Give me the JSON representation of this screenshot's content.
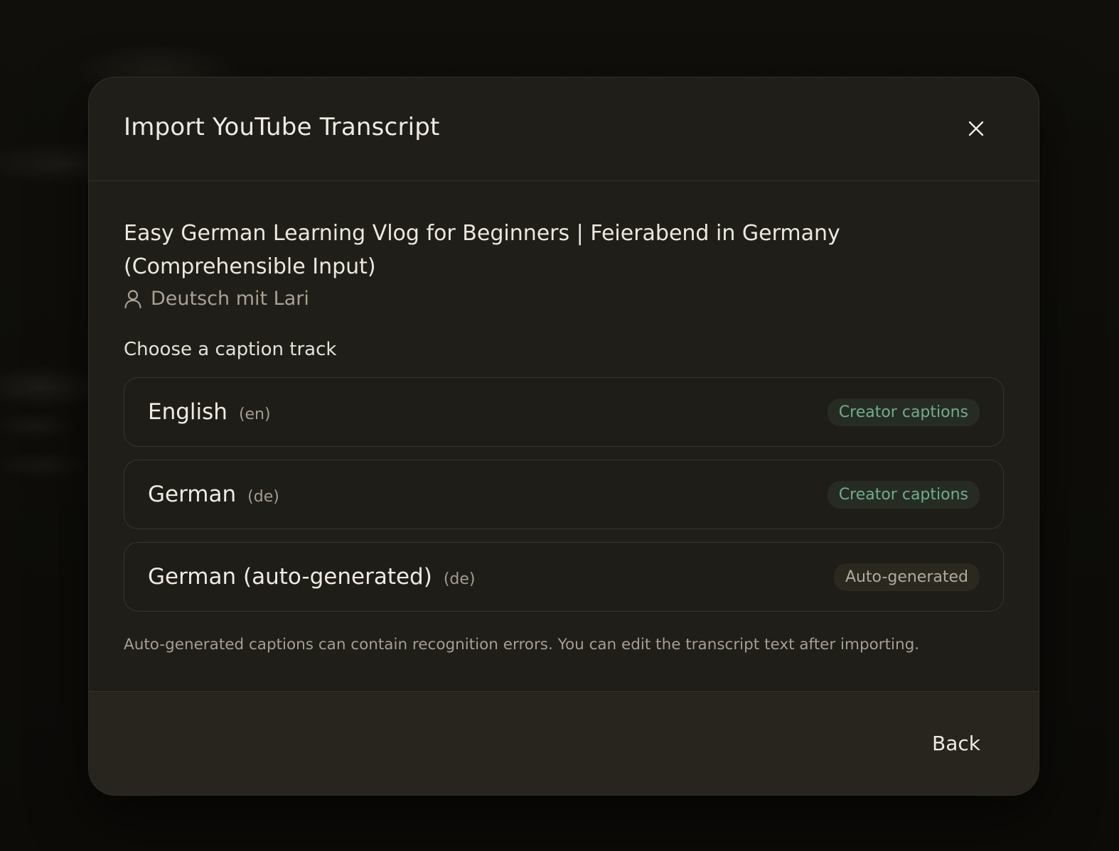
{
  "dialog": {
    "title": "Import YouTube Transcript",
    "close_icon": "close-icon"
  },
  "video": {
    "title": "Easy German Learning Vlog for Beginners | Feierabend in Germany (Comprehensible Input)",
    "channel": "Deutsch mit Lari",
    "channel_icon": "user-icon"
  },
  "tracks_section": {
    "label": "Choose a caption track",
    "items": [
      {
        "name": "English",
        "code": "(en)",
        "badge": "Creator captions",
        "badge_type": "creator"
      },
      {
        "name": "German",
        "code": "(de)",
        "badge": "Creator captions",
        "badge_type": "creator"
      },
      {
        "name": "German (auto-generated)",
        "code": "(de)",
        "badge": "Auto-generated",
        "badge_type": "auto"
      }
    ]
  },
  "note": "Auto-generated captions can contain recognition errors. You can edit the transcript text after importing.",
  "footer": {
    "back_label": "Back"
  },
  "colors": {
    "modal_bg": "#201e18",
    "creator_badge": "#6fae87",
    "auto_badge": "#b1ab9d"
  }
}
